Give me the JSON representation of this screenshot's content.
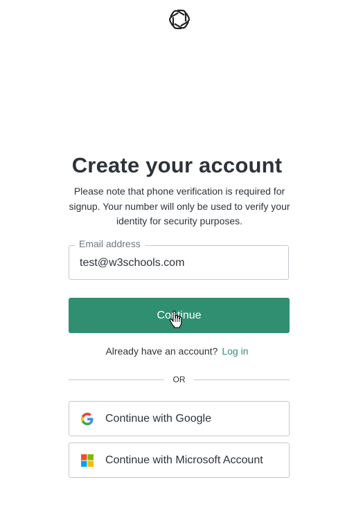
{
  "logo": {
    "icon": "openai-logo-icon"
  },
  "heading": {
    "title": "Create your account"
  },
  "notice": {
    "text": "Please note that phone verification is required for signup. Your number will only be used to verify your identity for security purposes."
  },
  "email": {
    "label": "Email address",
    "value": "test@w3schools.com"
  },
  "continue_button": {
    "label": "Continue"
  },
  "login_prompt": {
    "text": "Already have an account?",
    "link_label": "Log in"
  },
  "divider": {
    "label": "OR"
  },
  "social": [
    {
      "label": "Continue with Google",
      "icon": "google-icon"
    },
    {
      "label": "Continue with Microsoft Account",
      "icon": "microsoft-icon"
    }
  ],
  "colors": {
    "accent": "#318f71",
    "border": "#c2c8d0",
    "text": "#2d333a"
  }
}
